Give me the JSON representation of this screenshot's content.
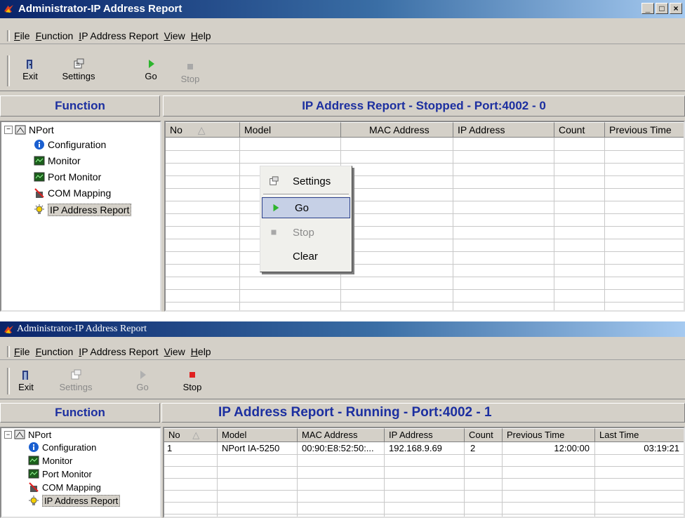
{
  "window1": {
    "title": "Administrator-IP Address Report",
    "menus": [
      "File",
      "Function",
      "IP Address Report",
      "View",
      "Help"
    ],
    "toolbar": {
      "exit": "Exit",
      "settings": "Settings",
      "go": "Go",
      "stop": "Stop"
    },
    "function_header": "Function",
    "report_header": "IP Address Report - Stopped - Port:4002 - 0",
    "tree": {
      "root": "NPort",
      "items": [
        "Configuration",
        "Monitor",
        "Port Monitor",
        "COM Mapping",
        "IP Address Report"
      ]
    },
    "columns": [
      "No",
      "Model",
      "MAC Address",
      "IP Address",
      "Count",
      "Previous Time"
    ],
    "context_menu": {
      "settings": "Settings",
      "go": "Go",
      "stop": "Stop",
      "clear": "Clear"
    }
  },
  "window2": {
    "title": "Administrator-IP Address Report",
    "menus": [
      "File",
      "Function",
      "IP Address Report",
      "View",
      "Help"
    ],
    "toolbar": {
      "exit": "Exit",
      "settings": "Settings",
      "go": "Go",
      "stop": "Stop"
    },
    "function_header": "Function",
    "report_header": "IP Address Report - Running - Port:4002 - 1",
    "tree": {
      "root": "NPort",
      "items": [
        "Configuration",
        "Monitor",
        "Port Monitor",
        "COM Mapping",
        "IP Address Report"
      ]
    },
    "columns": [
      "No",
      "Model",
      "MAC Address",
      "IP Address",
      "Count",
      "Previous Time",
      "Last Time"
    ],
    "rows": [
      {
        "no": "1",
        "model": "NPort IA-5250",
        "mac": "00:90:E8:52:50:...",
        "ip": "192.168.9.69",
        "count": "2",
        "previous": "12:00:00",
        "last": "03:19:21"
      }
    ]
  },
  "colors": {
    "title_start": "#0a246a",
    "header_text": "#1c2fa0",
    "go_green": "#2db52d",
    "stop_red": "#e02020"
  }
}
